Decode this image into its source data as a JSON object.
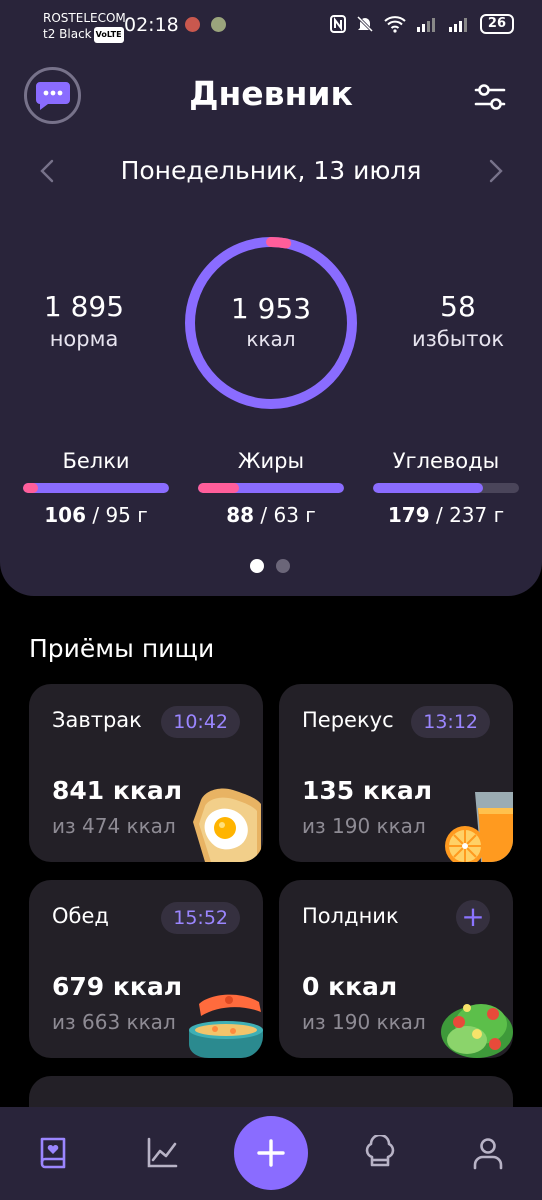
{
  "status_bar": {
    "carrier_line1": "ROSTELECOM",
    "carrier_line2": "t2 Black",
    "volte": "VoLTE",
    "time": "02:18",
    "battery": "26"
  },
  "header": {
    "title": "Дневник",
    "date": "Понедельник,  13 июля"
  },
  "summary": {
    "norm_value": "1 895",
    "norm_label": "норма",
    "eaten_value": "1 953",
    "eaten_unit": "ккал",
    "excess_value": "58",
    "excess_label": "избыток",
    "ring_progress": 1.03
  },
  "macros": [
    {
      "name": "Белки",
      "eaten": "106",
      "goal": " / 95 г",
      "fraction": 1.116
    },
    {
      "name": "Жиры",
      "eaten": "88",
      "goal": " / 63 г",
      "fraction": 1.397
    },
    {
      "name": "Углеводы",
      "eaten": "179",
      "goal": " / 237 г",
      "fraction": 0.755
    }
  ],
  "pager": {
    "pages": 2,
    "active": 0
  },
  "meals_section": {
    "title": "Приёмы пищи",
    "items": [
      {
        "name": "Завтрак",
        "time": "10:42",
        "kcal": "841 ккал",
        "norm": "из 474 ккал",
        "art": "toast-egg-icon"
      },
      {
        "name": "Перекус",
        "time": "13:12",
        "kcal": "135 ккал",
        "norm": "из 190 ккал",
        "art": "juice-orange-icon"
      },
      {
        "name": "Обед",
        "time": "15:52",
        "kcal": "679 ккал",
        "norm": "из 663 ккал",
        "art": "soup-pot-icon"
      },
      {
        "name": "Полдник",
        "time": "",
        "kcal": "0 ккал",
        "norm": "из 190 ккал",
        "art": "salad-icon"
      }
    ]
  },
  "colors": {
    "accent": "#8a6cff",
    "card": "#29243a",
    "tile": "#232027",
    "over": "#ff5e9a"
  }
}
